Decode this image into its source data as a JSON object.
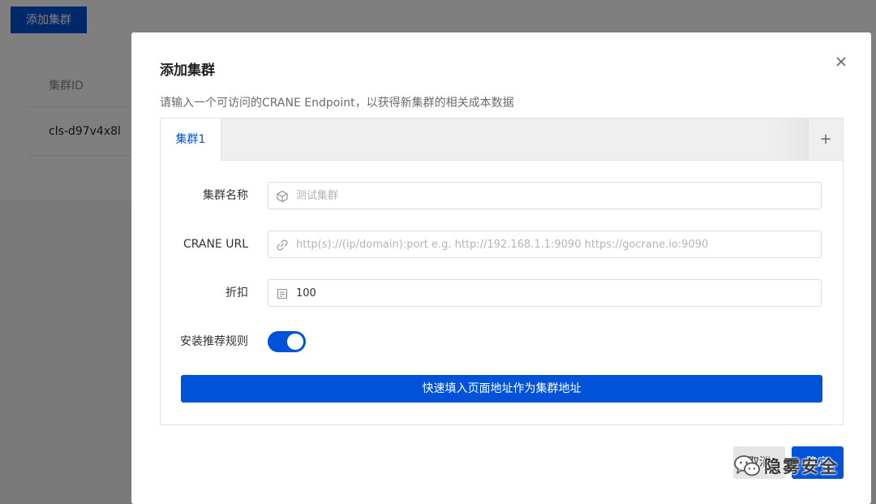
{
  "background": {
    "add_cluster_button": "添加集群",
    "table_header_cluster_id": "集群ID",
    "table_row_cluster_id": "cls-d97v4x8l"
  },
  "dialog": {
    "title": "添加集群",
    "description": "请输入一个可访问的CRANE Endpoint，以获得新集群的相关成本数据",
    "tabs": [
      {
        "label": "集群1",
        "active": true
      }
    ],
    "add_tab_label": "+",
    "form": {
      "name_label": "集群名称",
      "name_placeholder": "测试集群",
      "name_icon": "cube-icon",
      "url_label": "CRANE URL",
      "url_placeholder": "http(s)://(ip/domain):port e.g. http://192.168.1.1:9090 https://gocrane.io:9090",
      "url_icon": "link-icon",
      "discount_label": "折扣",
      "discount_value": "100",
      "discount_icon": "document-icon",
      "recommend_label": "安装推荐规则",
      "recommend_enabled": true
    },
    "fill_button": "快速填入页面地址作为集群地址",
    "cancel_button": "取消",
    "ok_button": "确定"
  },
  "watermark": {
    "text": "隐雾安全"
  },
  "colors": {
    "primary": "#0052d9",
    "overlay": "rgba(0,0,0,0.5)"
  }
}
